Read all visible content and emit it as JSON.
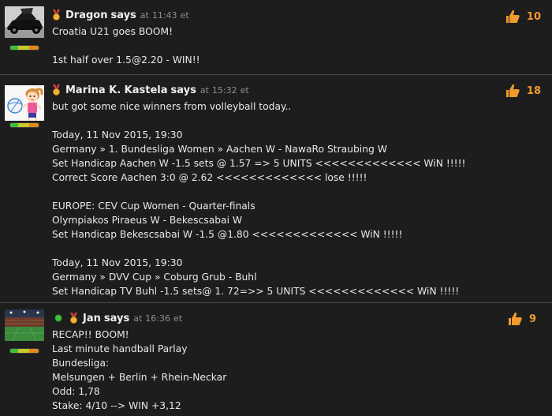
{
  "comments": [
    {
      "author": "Dragon",
      "says": "says",
      "at": "at",
      "time": "11:43",
      "tz": "et",
      "likes": "10",
      "online": false,
      "avatar": "car-avatar",
      "lines": [
        "Croatia U21 goes BOOM!",
        "",
        "1st half over 1.5@2.20 - WIN!!"
      ]
    },
    {
      "author": "Marina K. Kastela",
      "says": "says",
      "at": "at",
      "time": "15:32",
      "tz": "et",
      "likes": "18",
      "online": false,
      "avatar": "volleyball-girl-avatar",
      "lines": [
        "but got some nice winners from volleyball today..",
        "",
        "Today, 11 Nov 2015, 19:30",
        "Germany » 1. Bundesliga Women » Aachen W - NawaRo Straubing W",
        "Set Handicap Aachen W -1.5 sets @ 1.57 => 5 UNITS <<<<<<<<<<<<< WiN !!!!!",
        "Correct Score Aachen 3:0 @ 2.62 <<<<<<<<<<<<< lose !!!!!",
        "",
        "EUROPE: CEV Cup Women - Quarter-finals",
        "Olympiakos Piraeus W - Bekescsabai W",
        "Set Handicap Bekescsabai W -1.5 @1.80 <<<<<<<<<<<<< WiN !!!!!",
        "",
        "Today, 11 Nov 2015, 19:30",
        "Germany » DVV Cup » Coburg Grub - Buhl",
        "Set Handicap TV Buhl -1.5 sets@ 1. 72=>> 5 UNITS <<<<<<<<<<<<< WiN !!!!!"
      ]
    },
    {
      "author": "Jan",
      "says": "says",
      "at": "at",
      "time": "16:36",
      "tz": "et",
      "likes": "9",
      "online": true,
      "avatar": "stadium-avatar",
      "lines": [
        "RECAP!! BOOM!",
        "Last minute handball Parlay",
        "Bundesliga:",
        "Melsungen + Berlin + Rhein-Neckar",
        "Odd: 1,78",
        "Stake: 4/10 --> WIN +3,12"
      ]
    }
  ],
  "colors": {
    "accent": "#f09a2e",
    "online": "#3fbf3f",
    "background": "#1d1d1d"
  },
  "icons": {
    "rank": "medal-icon",
    "like": "thumbs-up-icon",
    "status": "online-dot"
  }
}
